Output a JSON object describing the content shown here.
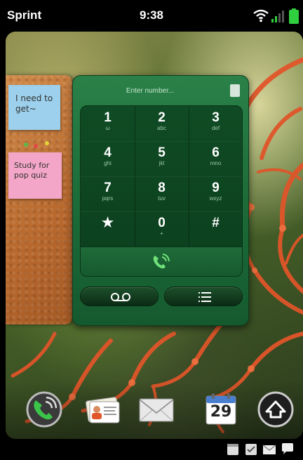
{
  "status_bar": {
    "carrier": "Sprint",
    "time": "9:38",
    "icons": [
      "wifi-icon",
      "signal-icon",
      "battery-icon"
    ],
    "battery_color": "#2fcf3f"
  },
  "notes_card": {
    "notes": [
      {
        "text": "I need to get~",
        "color": "#9cd0ec"
      },
      {
        "text": "Study for pop quiz",
        "color": "#f3a6c7"
      }
    ]
  },
  "dialer": {
    "number_placeholder": "Enter number...",
    "keys": [
      {
        "digit": "1",
        "letters": "ω"
      },
      {
        "digit": "2",
        "letters": "abc"
      },
      {
        "digit": "3",
        "letters": "def"
      },
      {
        "digit": "4",
        "letters": "ghi"
      },
      {
        "digit": "5",
        "letters": "jkl"
      },
      {
        "digit": "6",
        "letters": "mno"
      },
      {
        "digit": "7",
        "letters": "pqrs"
      },
      {
        "digit": "8",
        "letters": "tuv"
      },
      {
        "digit": "9",
        "letters": "wxyz"
      },
      {
        "digit": "★",
        "letters": ""
      },
      {
        "digit": "0",
        "letters": "+"
      },
      {
        "digit": "#",
        "letters": ""
      }
    ],
    "call_icon": "phone-call-icon",
    "voicemail_icon": "voicemail-icon",
    "call_log_icon": "list-icon",
    "accent": "#1f7a3f"
  },
  "dock": {
    "apps": [
      "phone-icon",
      "contacts-icon",
      "email-icon",
      "calendar-icon",
      "launcher-icon"
    ],
    "calendar_day": "29"
  },
  "notifications": [
    "calendar-notification-icon",
    "tasks-notification-icon",
    "email-notification-icon",
    "messaging-notification-icon"
  ]
}
